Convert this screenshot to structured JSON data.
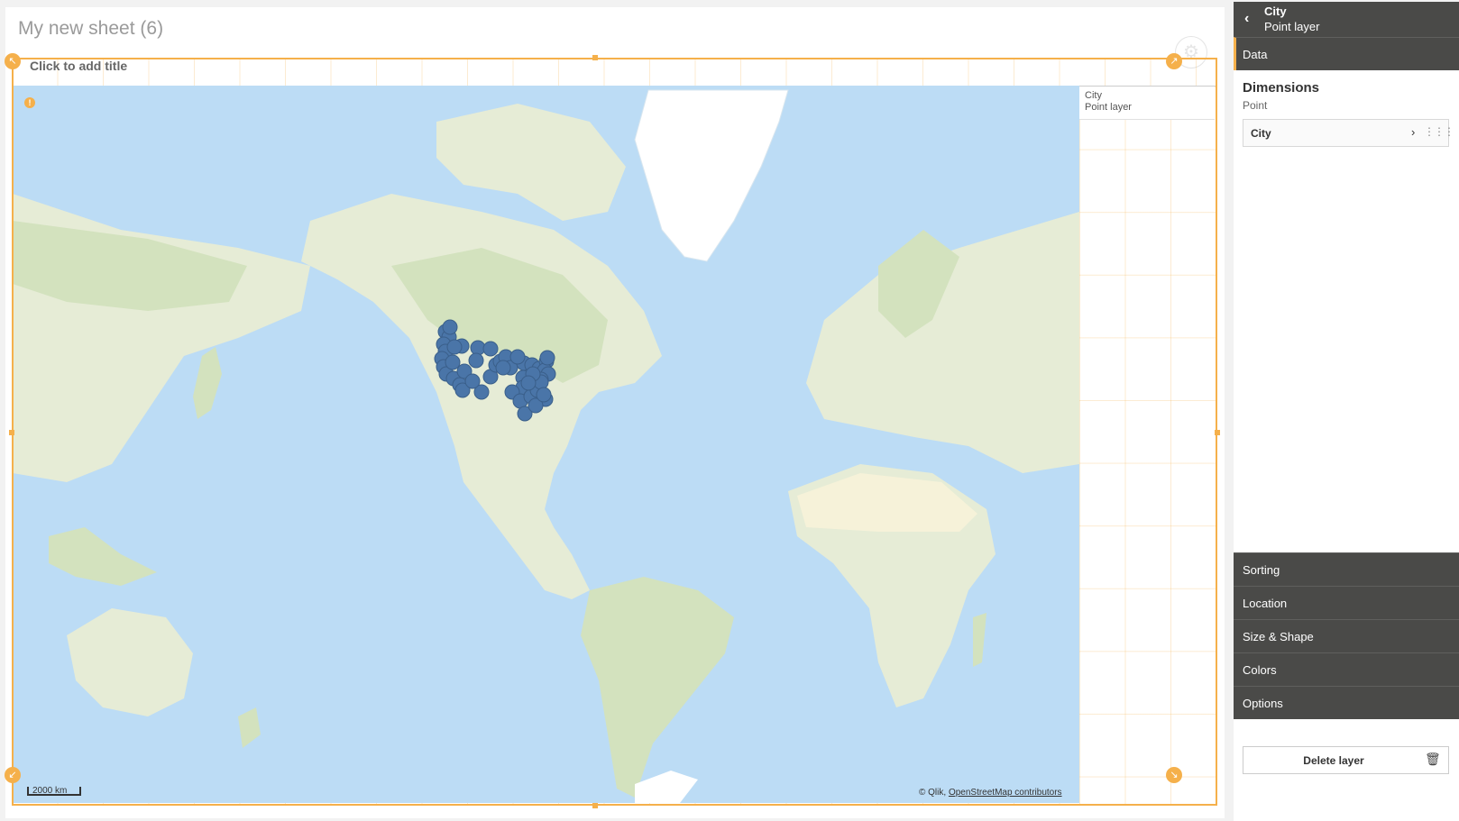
{
  "sheet": {
    "title": "My new sheet (6)"
  },
  "viz": {
    "title_placeholder": "Click to add title",
    "legend": {
      "title": "City",
      "subtitle": "Point layer"
    },
    "map": {
      "scale_label": "2000 km",
      "attribution_prefix": "© Qlik,",
      "attribution_link": "OpenStreetMap contributors",
      "colors": {
        "water": "#bcdcf5",
        "land": "#e6ecd6",
        "forest": "#d3e2be",
        "ice": "#ffffff",
        "desert": "#f6f2d9",
        "points": "#4a75a8"
      },
      "point_count": 50
    }
  },
  "panel": {
    "header": {
      "title": "City",
      "subtitle": "Point layer"
    },
    "sections": {
      "data": "Data",
      "sorting": "Sorting",
      "location": "Location",
      "size_shape": "Size & Shape",
      "colors": "Colors",
      "options": "Options"
    },
    "dimensions": {
      "heading": "Dimensions",
      "subheading": "Point",
      "items": [
        {
          "label": "City"
        }
      ]
    },
    "delete_label": "Delete layer"
  }
}
